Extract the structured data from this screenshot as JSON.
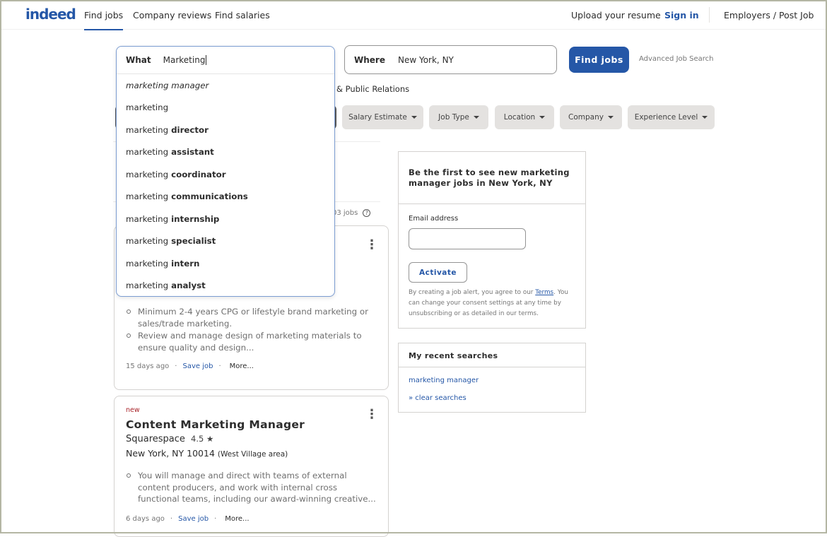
{
  "header": {
    "logo": "indeed",
    "nav": [
      "Find jobs",
      "Company reviews",
      "Find salaries"
    ],
    "upload": "Upload your resume",
    "signin": "Sign in",
    "employers": "Employers / Post Job"
  },
  "search": {
    "what_label": "What",
    "what_value": "Marketing",
    "where_label": "Where",
    "where_value": "New York, NY",
    "find_button": "Find jobs",
    "advanced": "Advanced Job Search"
  },
  "suggestions": [
    {
      "prefix": "marketing manager",
      "suffix": "",
      "italic": true
    },
    {
      "prefix": "marketing",
      "suffix": ""
    },
    {
      "prefix": "marketing",
      "suffix": "director"
    },
    {
      "prefix": "marketing",
      "suffix": "assistant"
    },
    {
      "prefix": "marketing",
      "suffix": "coordinator"
    },
    {
      "prefix": "marketing",
      "suffix": "communications"
    },
    {
      "prefix": "marketing",
      "suffix": "internship"
    },
    {
      "prefix": "marketing",
      "suffix": "specialist"
    },
    {
      "prefix": "marketing",
      "suffix": "intern"
    },
    {
      "prefix": "marketing",
      "suffix": "analyst"
    }
  ],
  "category_partial": "& Public Relations",
  "filters": [
    "Salary Estimate",
    "Job Type",
    "Location",
    "Company",
    "Experience Level"
  ],
  "job_count_partial": "03 jobs",
  "jobs": [
    {
      "bullets": [
        "Minimum 2-4 years CPG or lifestyle brand marketing or sales/trade marketing.",
        "Review and manage design of marketing materials to ensure quality and design..."
      ],
      "age": "15 days ago",
      "save": "Save job",
      "more": "More..."
    },
    {
      "badge": "new",
      "title": "Content Marketing Manager",
      "company": "Squarespace",
      "rating": "4.5 ★",
      "location": "New York, NY 10014",
      "area": "(West Village area)",
      "bullets": [
        "You will manage and direct with teams of external content producers, and work with internal cross functional teams, including our award-winning creative..."
      ],
      "age": "6 days ago",
      "save": "Save job",
      "more": "More..."
    }
  ],
  "alert": {
    "title": "Be the first to see new marketing manager jobs in New York, NY",
    "email_label": "Email address",
    "email_value": "",
    "activate": "Activate",
    "legal_pre": "By creating a job alert, you agree to our ",
    "terms": "Terms",
    "legal_post": ". You can change your consent settings at any time by unsubscribing or as detailed in our terms."
  },
  "recent": {
    "title": "My recent searches",
    "items": [
      "marketing manager"
    ],
    "clear": "» clear searches"
  },
  "colors": {
    "brand": "#2557a7",
    "new_badge": "#a9252b"
  }
}
